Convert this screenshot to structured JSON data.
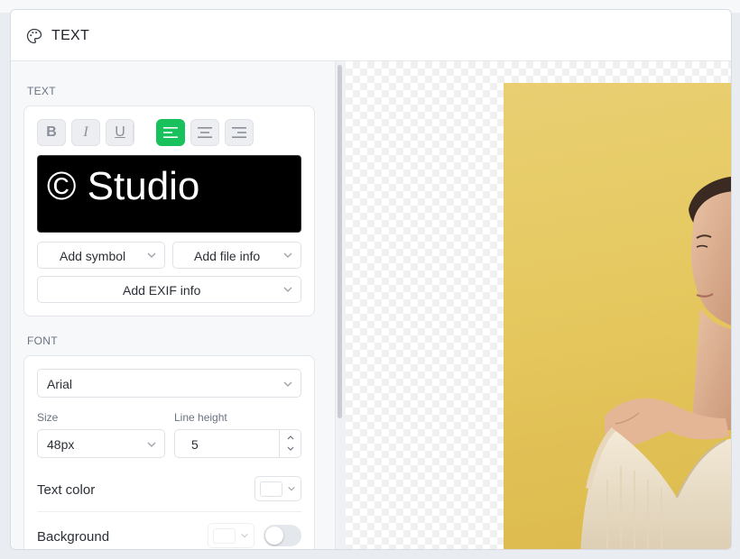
{
  "window": {
    "title": "TEXT"
  },
  "text_section": {
    "label": "TEXT",
    "preview_text": "© Studio",
    "format_buttons": [
      {
        "name": "bold",
        "glyph": "B",
        "active": false
      },
      {
        "name": "italic",
        "glyph": "I",
        "active": false
      },
      {
        "name": "underline",
        "glyph": "U",
        "active": false
      },
      {
        "name": "align-left",
        "glyph": "",
        "active": true
      },
      {
        "name": "align-center",
        "glyph": "",
        "active": false
      },
      {
        "name": "align-right",
        "glyph": "",
        "active": false
      }
    ],
    "add_symbol": "Add symbol",
    "add_file_info": "Add file info",
    "add_exif_info": "Add EXIF info"
  },
  "font_section": {
    "label": "FONT",
    "family": "Arial",
    "size_label": "Size",
    "size_value": "48px",
    "line_height_label": "Line height",
    "line_height_value": "5",
    "text_color_label": "Text color",
    "text_color": "#ffffff",
    "background_label": "Background",
    "background_color": "#ffffff",
    "background_enabled": false
  },
  "colors": {
    "accent": "#19c15d",
    "photo_background": "#e5c85f"
  },
  "icons": {
    "title_icon": "palette-icon",
    "dropdown_icon": "chevron-down-icon"
  }
}
